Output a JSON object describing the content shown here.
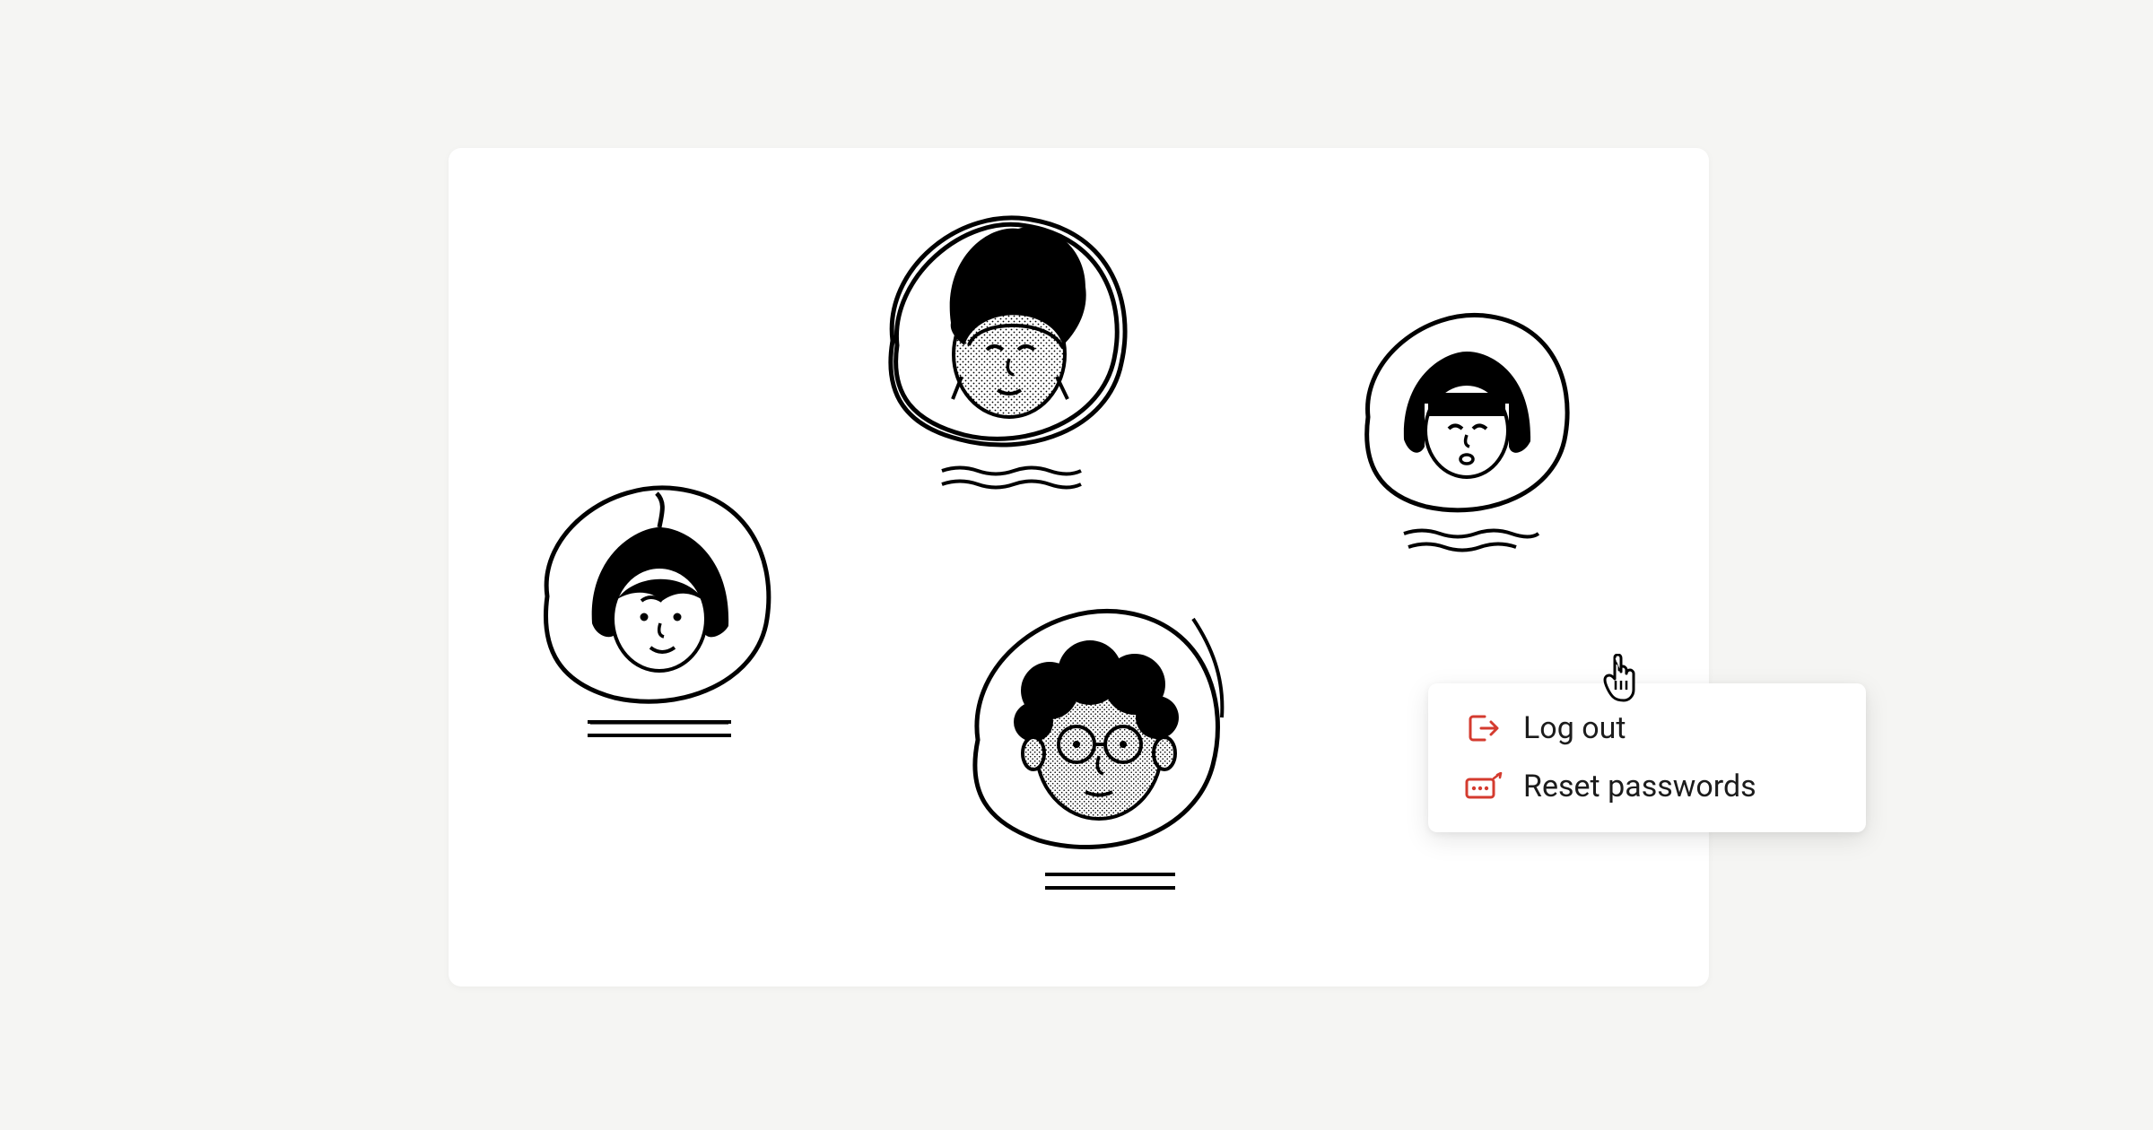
{
  "menu": {
    "items": [
      {
        "label": "Log out"
      },
      {
        "label": "Reset passwords"
      }
    ]
  },
  "icons": {
    "logout": "logout-icon",
    "reset": "reset-password-icon",
    "cursor": "pointer-cursor-icon"
  },
  "colors": {
    "danger": "#d43b2f",
    "text": "#1c1c1c",
    "bg": "#f5f5f3"
  },
  "avatars": [
    {
      "name": "avatar-1"
    },
    {
      "name": "avatar-2"
    },
    {
      "name": "avatar-3"
    },
    {
      "name": "avatar-4"
    }
  ]
}
